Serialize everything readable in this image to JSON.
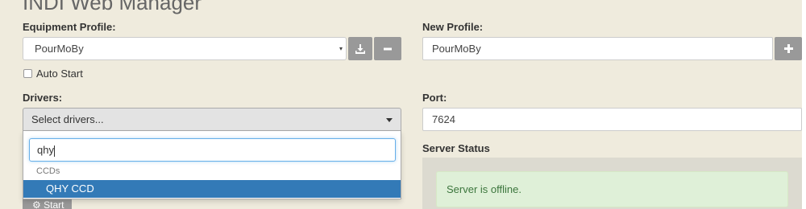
{
  "header": {
    "title": "INDI Web Manager"
  },
  "equipment_profile": {
    "label": "Equipment Profile:",
    "selected": "PourMoBy",
    "arrow_icon": "▾",
    "save_icon": "download-icon",
    "remove_icon": "minus-icon"
  },
  "new_profile": {
    "label": "New Profile:",
    "value": "PourMoBy",
    "add_icon": "plus-icon"
  },
  "auto_start": {
    "label": "Auto Start",
    "checked": false
  },
  "drivers": {
    "label": "Drivers:",
    "placeholder": "Select drivers...",
    "dropdown": {
      "search_value": "qhy",
      "group": "CCDs",
      "options": [
        "QHY CCD"
      ],
      "highlighted": "QHY CCD"
    }
  },
  "port": {
    "label": "Port:",
    "value": "7624"
  },
  "start": {
    "label": "Start",
    "icon": "gear-icon"
  },
  "server_status": {
    "label": "Server Status",
    "message": "Server is offline."
  },
  "colors": {
    "background": "#efebdd",
    "button_gray": "#999999",
    "highlight_blue": "#337ab7",
    "success_bg": "#dff0d8",
    "success_text": "#3c763d"
  }
}
